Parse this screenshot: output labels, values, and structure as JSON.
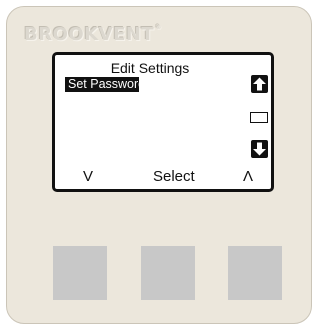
{
  "brand": {
    "name": "BROOKVENT",
    "mark": "®"
  },
  "screen": {
    "title": "Edit Settings",
    "selected_item": "Set Password",
    "softkeys": {
      "left": "V",
      "middle": "Select",
      "right": "Λ"
    },
    "icons": {
      "up": "arrow-up-icon",
      "down": "arrow-down-icon",
      "scroll": "scroll-indicator"
    }
  },
  "buttons": [
    {
      "name": "left-button"
    },
    {
      "name": "middle-button"
    },
    {
      "name": "right-button"
    }
  ],
  "colors": {
    "housing": "#ece7dc",
    "screen_border": "#111111",
    "highlight": "#111111",
    "button": "#c8c8c8"
  }
}
